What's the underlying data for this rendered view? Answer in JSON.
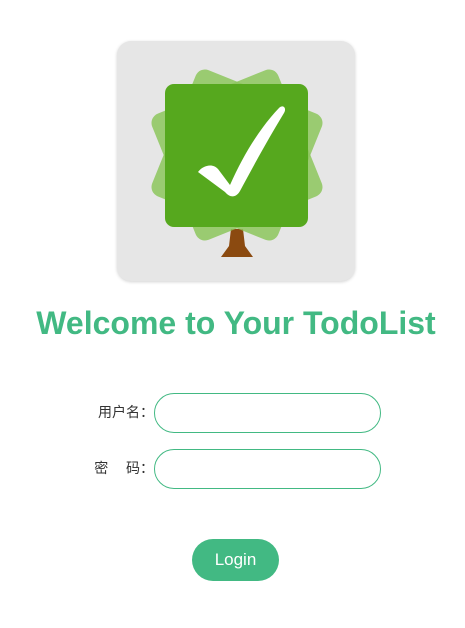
{
  "logo": {
    "icon": "checkmark-tree-icon",
    "tile_color": "#e6e6e6",
    "leaf_light_color": "#7dc24a",
    "leaf_dark_color": "#56a81e",
    "trunk_color": "#8b4a10"
  },
  "title": "Welcome to Your TodoList",
  "form": {
    "username_label": "用户名：",
    "username_value": "",
    "username_placeholder": "",
    "password_label": "密    码：",
    "password_value": "",
    "password_placeholder": ""
  },
  "login_button": "Login",
  "colors": {
    "accent": "#42b983",
    "background": "#ffffff"
  }
}
